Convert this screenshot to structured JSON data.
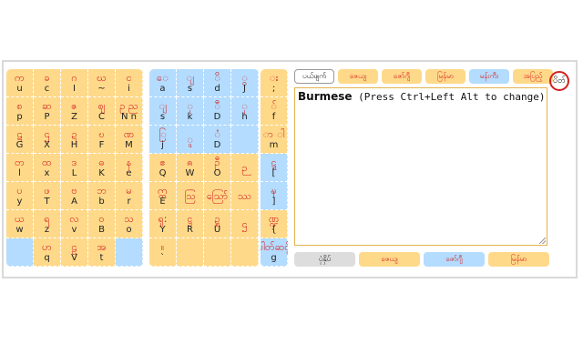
{
  "keyboard_left": [
    {
      "my": "က",
      "la": "u"
    },
    {
      "my": "ခ",
      "la": "c"
    },
    {
      "my": "ဂ",
      "la": "I"
    },
    {
      "my": "ဃ",
      "la": "~"
    },
    {
      "my": "င",
      "la": "i"
    },
    {
      "my": "စ",
      "la": "p"
    },
    {
      "my": "ဆ",
      "la": "P"
    },
    {
      "my": "ဇ",
      "la": "Z"
    },
    {
      "my": "ဈ",
      "la": "C"
    },
    {
      "my": "ဥ ည",
      "la": "N n"
    },
    {
      "my": "ဋ",
      "la": "G"
    },
    {
      "my": "ဌ",
      "la": "X"
    },
    {
      "my": "ဍ",
      "la": "H"
    },
    {
      "my": "ဎ",
      "la": "F"
    },
    {
      "my": "ဏ",
      "la": "M"
    },
    {
      "my": "တ",
      "la": "l"
    },
    {
      "my": "ထ",
      "la": "x"
    },
    {
      "my": "ဒ",
      "la": "L"
    },
    {
      "my": "ဓ",
      "la": "K"
    },
    {
      "my": "န",
      "la": "e"
    },
    {
      "my": "ပ",
      "la": "y"
    },
    {
      "my": "ဖ",
      "la": "T"
    },
    {
      "my": "ဗ",
      "la": "A"
    },
    {
      "my": "ဘ",
      "la": "b"
    },
    {
      "my": "မ",
      "la": "r"
    },
    {
      "my": "ယ",
      "la": "w"
    },
    {
      "my": "ရ",
      "la": "z"
    },
    {
      "my": "လ",
      "la": "v"
    },
    {
      "my": "ဝ",
      "la": "B"
    },
    {
      "my": "သ",
      "la": "o"
    },
    {
      "my": "",
      "la": "",
      "c": "b"
    },
    {
      "my": "ဟ",
      "la": "q"
    },
    {
      "my": "ဠ",
      "la": "V"
    },
    {
      "my": "အ",
      "la": "t"
    },
    {
      "my": "",
      "la": "",
      "c": "b"
    }
  ],
  "keyboard_mid": [
    {
      "my": "ေ",
      "la": "a",
      "c": "b"
    },
    {
      "my": "ျ",
      "la": "s",
      "c": "b"
    },
    {
      "my": "ိ",
      "la": "d",
      "c": "b"
    },
    {
      "my": "ွ",
      "la": "J",
      "c": "b"
    },
    {
      "my": "ျ",
      "la": "s",
      "c": "b"
    },
    {
      "my": "ု",
      "la": "k",
      "c": "b"
    },
    {
      "my": "ီ",
      "la": "D",
      "c": "b"
    },
    {
      "my": "ှ",
      "la": "h",
      "c": "b"
    },
    {
      "my": "ြ",
      "la": "j",
      "c": "b"
    },
    {
      "my": "ူ",
      "la": "",
      "c": "b"
    },
    {
      "my": "ံ",
      "la": "D",
      "c": "b"
    },
    {
      "my": "",
      "la": "",
      "c": "b"
    },
    {
      "my": "ဧ",
      "la": "Q"
    },
    {
      "my": "ၐ",
      "la": "W"
    },
    {
      "my": "ဦ",
      "la": "O"
    },
    {
      "my": "ဉ",
      "la": ""
    },
    {
      "my": "ဣ",
      "la": "E"
    },
    {
      "my": "ဩ",
      "la": ""
    },
    {
      "my": "ဪ",
      "la": ""
    },
    {
      "my": "ဿ",
      "la": ""
    },
    {
      "my": "ရှ:",
      "la": "Y"
    },
    {
      "my": "ဋ္ဌ",
      "la": "R"
    },
    {
      "my": "ဍ္ဍ",
      "la": "U"
    },
    {
      "my": "ဌ",
      "la": ""
    },
    {
      "my": "။",
      "la": "`"
    },
    {
      "my": "",
      "la": ""
    },
    {
      "my": "",
      "la": ""
    },
    {
      "my": "",
      "la": ""
    }
  ],
  "keyboard_right": [
    {
      "my": "း",
      "la": ";"
    },
    {
      "my": "်",
      "la": "f"
    },
    {
      "my": "ာ ါ",
      "la": "m"
    },
    {
      "my": "ဋ္ဋ",
      "la": "[",
      "c": "b"
    },
    {
      "my": "ဍ္ဎ",
      "la": "]",
      "c": "b"
    },
    {
      "my": "ဏ္ဍ",
      "la": "{"
    },
    {
      "my": "ပါတ်ဆင့်",
      "la": "g",
      "c": "b"
    }
  ],
  "top_buttons": [
    {
      "label": "ပယ်ဖျက်",
      "w": 44,
      "style": "gray"
    },
    {
      "label": "ဇေယျ",
      "w": 44,
      "style": ""
    },
    {
      "label": "ဇော်ဂျီ",
      "w": 44,
      "style": ""
    },
    {
      "label": "မြန်မာ",
      "w": 44,
      "style": ""
    },
    {
      "label": "မန်းကီး",
      "w": 44,
      "style": "blue"
    },
    {
      "label": "အပြည့်",
      "w": 44,
      "style": ""
    }
  ],
  "circle_label": "ပိတ်",
  "editor": {
    "lang": "Burmese",
    "hint": "(Press Ctrl+Left Alt to change)"
  },
  "bottom_buttons": [
    {
      "label": "ပုံနှိပ်",
      "style": "gray"
    },
    {
      "label": "ဇေယျ",
      "style": ""
    },
    {
      "label": "ဇော်ဂျီ",
      "style": "blue"
    },
    {
      "label": "မြန်မာ",
      "style": ""
    }
  ],
  "colors": {
    "key_yellow": "#ffd98a",
    "key_blue": "#b3dcff",
    "text_red": "#d42020"
  }
}
